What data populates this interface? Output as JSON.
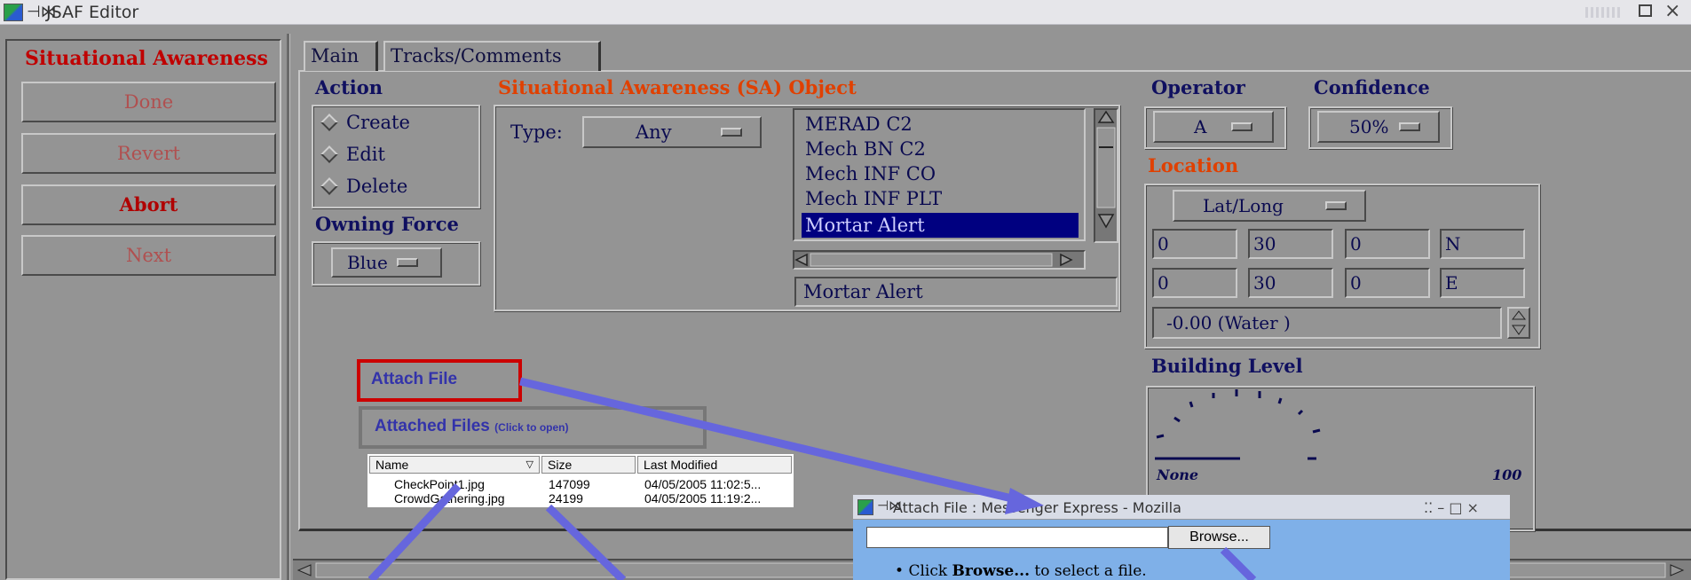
{
  "window": {
    "title": "JSAF Editor"
  },
  "left_panel": {
    "title": "Situational Awareness",
    "buttons": {
      "done": "Done",
      "revert": "Revert",
      "abort": "Abort",
      "next": "Next"
    }
  },
  "tabs": {
    "main": "Main",
    "tracks": "Tracks/Comments"
  },
  "action": {
    "label": "Action",
    "create": "Create",
    "edit": "Edit",
    "delete": "Delete"
  },
  "owning_force": {
    "label": "Owning Force",
    "value": "Blue"
  },
  "sa_object": {
    "label": "Situational Awareness (SA) Object",
    "type_label": "Type:",
    "type_value": "Any",
    "list": [
      "MERAD C2",
      "Mech BN C2",
      "Mech INF CO",
      "Mech INF PLT",
      "Mortar Alert"
    ],
    "selected": "Mortar Alert"
  },
  "operator": {
    "label": "Operator",
    "value": "A"
  },
  "confidence": {
    "label": "Confidence",
    "value": "50%"
  },
  "location": {
    "label": "Location",
    "mode": "Lat/Long",
    "lat": [
      "0",
      "30",
      "0",
      "N"
    ],
    "lon": [
      "0",
      "30",
      "0",
      "E"
    ],
    "elevation": "-0.00 (Water        )"
  },
  "building_level": {
    "label": "Building Level",
    "min_label": "None",
    "max_label": "100"
  },
  "attach": {
    "button_label": "Attach File",
    "attached_label": "Attached Files",
    "attached_hint": "(Click to open)",
    "columns": [
      "Name",
      "Size",
      "Last Modified"
    ],
    "rows": [
      {
        "name": "CheckPoint1.jpg",
        "size": "147099",
        "modified": "04/05/2005 11:02:5..."
      },
      {
        "name": "CrowdGathering.jpg",
        "size": "24199",
        "modified": "04/05/2005 11:19:2..."
      }
    ]
  },
  "dialog": {
    "title": "Attach File : Messenger Express - Mozilla",
    "browse_label": "Browse...",
    "instruction_prefix": "Click ",
    "instruction_bold": "Browse...",
    "instruction_suffix": " to select a file."
  },
  "colors": {
    "panel_bg": "#949494",
    "accent_red": "#c00000",
    "text_navy": "#0a0a50",
    "selection": "#000080",
    "annotation_arrow": "#6666dd",
    "annotation_highlight": "#cc0000",
    "dialog_bg": "#7fb0e8"
  }
}
